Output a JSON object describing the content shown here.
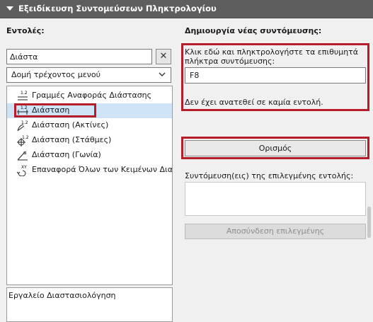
{
  "panel": {
    "title": "Εξειδίκευση Συντομεύσεων Πληκτρολογίου"
  },
  "commands": {
    "label": "Εντολές:",
    "search_value": "Διάστα",
    "clear_symbol": "✕",
    "dropdown_value": "Δομή τρέχοντος μενού",
    "items": [
      {
        "label": "Γραμμές Αναφοράς Διάστασης",
        "icon": "reference-line-dimension-icon",
        "badge": "1.2",
        "selected": false
      },
      {
        "label": "Διάσταση",
        "icon": "linear-dimension-icon",
        "badge": "1.2",
        "selected": true
      },
      {
        "label": "Διάσταση (Ακτίνες)",
        "icon": "radial-dimension-icon",
        "badge": "1.2",
        "selected": false
      },
      {
        "label": "Διάσταση (Στάθμες)",
        "icon": "level-dimension-icon",
        "badge": "1.2",
        "selected": false
      },
      {
        "label": "Διάσταση (Γωνία)",
        "icon": "angle-dimension-icon",
        "badge": "α",
        "selected": false
      },
      {
        "label": "Επαναφορά Όλων των Κειμένων Διαστ",
        "icon": "reset-dimension-text-icon",
        "badge": "XY",
        "selected": false
      }
    ],
    "description": "Εργαλείο Διαστασιολόγηση"
  },
  "new_shortcut": {
    "label": "Δημιουργία νέας συντόμευσης:",
    "instruction": "Κλικ εδώ και πληκτρολογήστε τα επιθυμητά πλήκτρα συντόμευσης:",
    "key_value": "F8",
    "status": "Δεν έχει ανατεθεί σε καμία εντολή.",
    "assign_label": "Ορισμός"
  },
  "current_shortcuts": {
    "label": "Συντόμευση(εις) της επιλεγμένης εντολής:",
    "items": [],
    "unassign_label": "Αποσύνδεση επιλεγμένης"
  },
  "colors": {
    "header_bg": "#5e5e5e",
    "highlight": "#b51d2a",
    "selection": "#cfe4f7"
  }
}
